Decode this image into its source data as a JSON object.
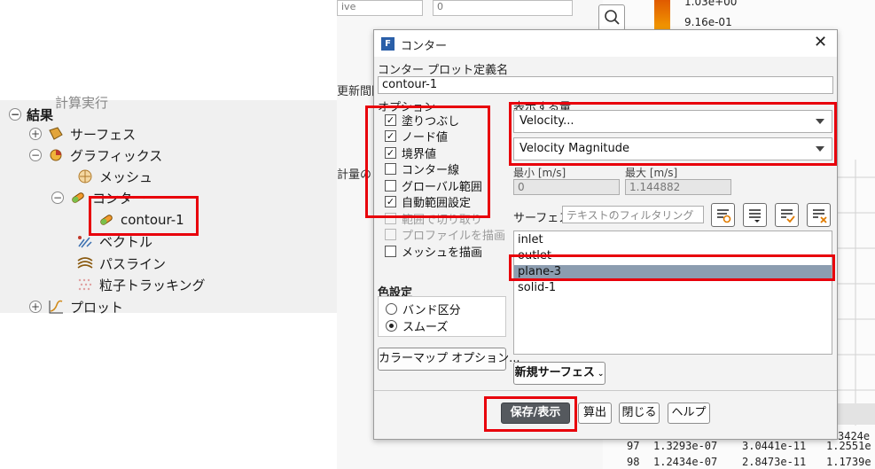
{
  "tree": {
    "top_cut": "計算実行",
    "results": "結果",
    "surfaces": "サーフェス",
    "graphics": "グラフィックス",
    "mesh": "メッシュ",
    "contour": "コンター",
    "contour_item": "contour-1",
    "vector": "ベクトル",
    "pathline": "パスライン",
    "particle": "粒子トラッキング",
    "plot": "プロット"
  },
  "background": {
    "combo1": "ive",
    "combo2": "0",
    "label_interval": "更新間隔",
    "label_measure": "計量の",
    "legend_val1": "1.03e+00",
    "legend_val2": "9.16e-01",
    "tbl_partial": "3424e",
    "rows": [
      {
        "n": "97",
        "a": "1.3293e-07",
        "b": "3.0441e-11",
        "c": "1.2551e"
      },
      {
        "n": "98",
        "a": "1.2434e-07",
        "b": "2.8473e-11",
        "c": "1.1739e"
      }
    ]
  },
  "dialog": {
    "title": "コンター",
    "name_label": "コンター プロット定義名",
    "name_value": "contour-1",
    "options_label": "オプション",
    "options": [
      {
        "label": "塗りつぶし",
        "checked": true,
        "disabled": false
      },
      {
        "label": "ノード値",
        "checked": true,
        "disabled": false
      },
      {
        "label": "境界値",
        "checked": true,
        "disabled": false
      },
      {
        "label": "コンター線",
        "checked": false,
        "disabled": false
      },
      {
        "label": "グローバル範囲",
        "checked": false,
        "disabled": false
      },
      {
        "label": "自動範囲設定",
        "checked": true,
        "disabled": false
      },
      {
        "label": "範囲で切り取り",
        "checked": false,
        "disabled": true
      },
      {
        "label": "プロファイルを描画",
        "checked": false,
        "disabled": true
      },
      {
        "label": "メッシュを描画",
        "checked": false,
        "disabled": false
      }
    ],
    "display_label": "表示する量",
    "quantity": "Velocity...",
    "sub_quantity": "Velocity Magnitude",
    "min_label": "最小 [m/s]",
    "max_label": "最大 [m/s]",
    "min_value": "0",
    "max_value": "1.144882",
    "surface_label": "サーフェス",
    "filter_placeholder": "テキストのフィルタリング",
    "surfaces": [
      "inlet",
      "outlet",
      "plane-3",
      "solid-1"
    ],
    "selected_surface": "plane-3",
    "color_label": "色設定",
    "color_options": [
      {
        "label": "バンド区分",
        "selected": false
      },
      {
        "label": "スムーズ",
        "selected": true
      }
    ],
    "colormap_button": "カラーマップ オプション...",
    "new_surface_button": "新規サーフェス",
    "save_button": "保存/表示",
    "compute_button": "算出",
    "close_button": "閉じる",
    "help_button": "ヘルプ"
  },
  "colors": {
    "highlight": "#e8000b",
    "selected_row": "#8c9db0",
    "primary_button": "#55595e"
  }
}
